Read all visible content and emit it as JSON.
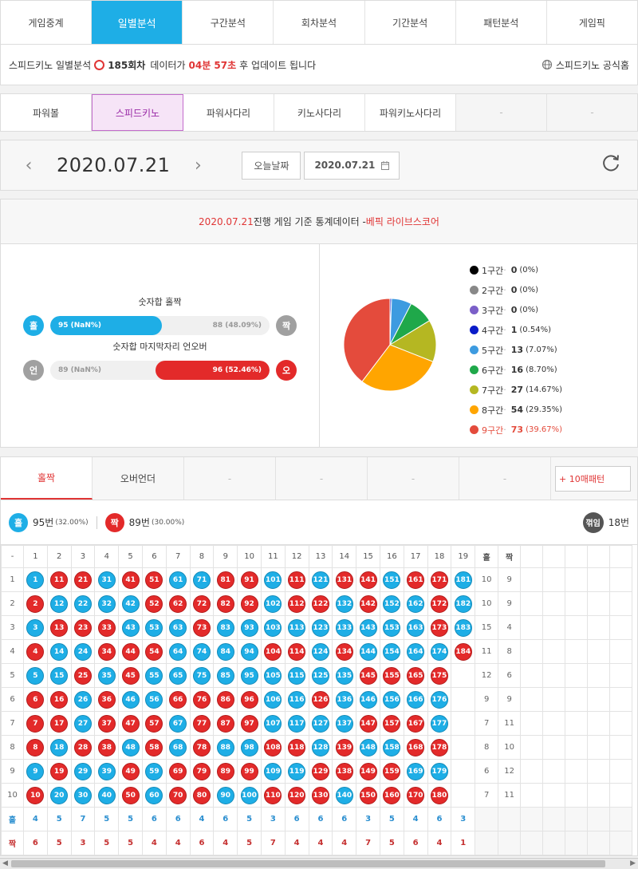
{
  "nav": [
    "게임중계",
    "일별분석",
    "구간분석",
    "회차분석",
    "기간분석",
    "패턴분석",
    "게임픽"
  ],
  "info": {
    "game": "스피드키노 일별분석",
    "round": "185회차",
    "text1": "데이터가",
    "time": "04분 57초",
    "text2": "후 업데이트 됩니다",
    "official": "스피드키노 공식홈"
  },
  "games": [
    "파워볼",
    "스피드키노",
    "파워사다리",
    "키노사다리",
    "파워키노사다리",
    "-",
    "-"
  ],
  "datebar": {
    "date": "2020.07.21",
    "today": "오늘날짜",
    "input": "2020.07.21"
  },
  "stat": {
    "date": "2020.07.21",
    "mid": " 진행 게임 기준 통계데이터 - ",
    "brand": "베픽 라이브스코어",
    "oddeven_title": "숫자합 홀짝",
    "odd": "홀",
    "even": "짝",
    "odd_label": "95 (NaN%)",
    "even_label": "88 (48.09%)",
    "underover_title": "숫자합 마지막자리 언오버",
    "under": "언",
    "over": "오",
    "under_label": "89 (NaN%)",
    "over_label": "96 (52.46%)"
  },
  "legend": [
    {
      "name": "1구간",
      "v": "0",
      "p": "(0%)",
      "color": "#000000"
    },
    {
      "name": "2구간",
      "v": "0",
      "p": "(0%)",
      "color": "#888888"
    },
    {
      "name": "3구간",
      "v": "0",
      "p": "(0%)",
      "color": "#7b5fc8"
    },
    {
      "name": "4구간",
      "v": "1",
      "p": "(0.54%)",
      "color": "#0a1bc8"
    },
    {
      "name": "5구간",
      "v": "13",
      "p": "(7.07%)",
      "color": "#3d9be0"
    },
    {
      "name": "6구간",
      "v": "16",
      "p": "(8.70%)",
      "color": "#1fa84a"
    },
    {
      "name": "7구간",
      "v": "27",
      "p": "(14.67%)",
      "color": "#b5b722"
    },
    {
      "name": "8구간",
      "v": "54",
      "p": "(29.35%)",
      "color": "#ffa500"
    },
    {
      "name": "9구간",
      "v": "73",
      "p": "(39.67%)",
      "color": "#e44b3c"
    }
  ],
  "chart_data": {
    "type": "pie",
    "categories": [
      "1구간",
      "2구간",
      "3구간",
      "4구간",
      "5구간",
      "6구간",
      "7구간",
      "8구간",
      "9구간"
    ],
    "values": [
      0,
      0,
      0,
      1,
      13,
      16,
      27,
      54,
      73
    ]
  },
  "pattern": {
    "tabs": [
      "홀짝",
      "오버언더",
      "-",
      "-",
      "-",
      "-",
      "-"
    ],
    "btn": "+ 10매패턴",
    "odd_label": "홀",
    "odd_count": "95번",
    "odd_pct": "(32.00%)",
    "even_label": "짝",
    "even_count": "89번",
    "even_pct": "(30.00%)",
    "turn_label": "꺾임",
    "turn_count": "18번"
  },
  "grid": {
    "corner": "-",
    "odd_header": "홀",
    "even_header": "짝",
    "columns": [
      "1",
      "2",
      "3",
      "4",
      "5",
      "6",
      "7",
      "8",
      "9",
      "10",
      "11",
      "12",
      "13",
      "14",
      "15",
      "16",
      "17",
      "18",
      "19"
    ],
    "colors": [
      "brrbrrbbrrbrbrrbrrb",
      "rbbbbrrrrrbrrbrbbrb",
      "brrrbbbrbbbbbbbbbrb",
      "rbbrrrbbbbrrbrbbbbr",
      "bbrbrbbbbbbbbbrrrr",
      "rrbrbbrrrrbbrbbbbb",
      "rrbrrrbrrrbbbbrrrb",
      "rbrrbrbrbbrrbrbbrr",
      "brbbrbrrrrbbrrrrbb",
      "rbbbrbrrbbrrrbrrrr"
    ],
    "numbers": [
      [
        "1",
        "11",
        "21",
        "31",
        "41",
        "51",
        "61",
        "71",
        "81",
        "91",
        "101",
        "111",
        "121",
        "131",
        "141",
        "151",
        "161",
        "171",
        "181"
      ],
      [
        "2",
        "12",
        "22",
        "32",
        "42",
        "52",
        "62",
        "72",
        "82",
        "92",
        "102",
        "112",
        "122",
        "132",
        "142",
        "152",
        "162",
        "172",
        "182"
      ],
      [
        "3",
        "13",
        "23",
        "33",
        "43",
        "53",
        "63",
        "73",
        "83",
        "93",
        "103",
        "113",
        "123",
        "133",
        "143",
        "153",
        "163",
        "173",
        "183"
      ],
      [
        "4",
        "14",
        "24",
        "34",
        "44",
        "54",
        "64",
        "74",
        "84",
        "94",
        "104",
        "114",
        "124",
        "134",
        "144",
        "154",
        "164",
        "174",
        "184"
      ],
      [
        "5",
        "15",
        "25",
        "35",
        "45",
        "55",
        "65",
        "75",
        "85",
        "95",
        "105",
        "115",
        "125",
        "135",
        "145",
        "155",
        "165",
        "175"
      ],
      [
        "6",
        "16",
        "26",
        "36",
        "46",
        "56",
        "66",
        "76",
        "86",
        "96",
        "106",
        "116",
        "126",
        "136",
        "146",
        "156",
        "166",
        "176"
      ],
      [
        "7",
        "17",
        "27",
        "37",
        "47",
        "57",
        "67",
        "77",
        "87",
        "97",
        "107",
        "117",
        "127",
        "137",
        "147",
        "157",
        "167",
        "177"
      ],
      [
        "8",
        "18",
        "28",
        "38",
        "48",
        "58",
        "68",
        "78",
        "88",
        "98",
        "108",
        "118",
        "128",
        "139",
        "148",
        "158",
        "168",
        "178"
      ],
      [
        "9",
        "19",
        "29",
        "39",
        "49",
        "59",
        "69",
        "79",
        "89",
        "99",
        "109",
        "119",
        "129",
        "138",
        "149",
        "159",
        "169",
        "179"
      ],
      [
        "10",
        "20",
        "30",
        "40",
        "50",
        "60",
        "70",
        "80",
        "90",
        "100",
        "110",
        "120",
        "130",
        "140",
        "150",
        "160",
        "170",
        "180"
      ]
    ],
    "row_odd": [
      "10",
      "10",
      "15",
      "11",
      "12",
      "9",
      "7",
      "8",
      "6",
      "7"
    ],
    "row_even": [
      "9",
      "9",
      "4",
      "8",
      "6",
      "9",
      "11",
      "10",
      "12",
      "11"
    ],
    "footer_odd_label": "홀",
    "footer_even_label": "짝",
    "footer_odd": [
      "4",
      "5",
      "7",
      "5",
      "5",
      "6",
      "6",
      "4",
      "6",
      "5",
      "3",
      "6",
      "6",
      "6",
      "3",
      "5",
      "4",
      "6",
      "3"
    ],
    "footer_even": [
      "6",
      "5",
      "3",
      "5",
      "5",
      "4",
      "4",
      "6",
      "4",
      "5",
      "7",
      "4",
      "4",
      "4",
      "7",
      "5",
      "6",
      "4",
      "1"
    ]
  }
}
